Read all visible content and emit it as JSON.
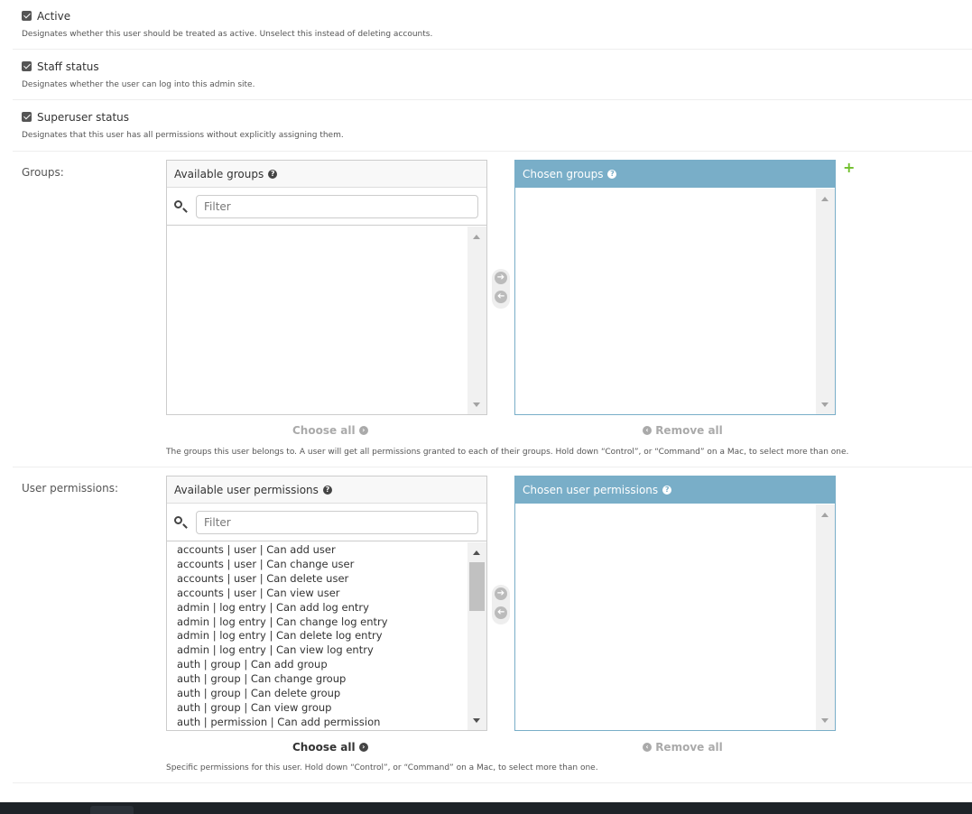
{
  "checkboxes": [
    {
      "label": "Active",
      "checked": true,
      "help": "Designates whether this user should be treated as active. Unselect this instead of deleting accounts."
    },
    {
      "label": "Staff status",
      "checked": true,
      "help": "Designates whether the user can log into this admin site."
    },
    {
      "label": "Superuser status",
      "checked": true,
      "help": "Designates that this user has all permissions without explicitly assigning them."
    }
  ],
  "groups": {
    "label": "Groups:",
    "available_title": "Available groups",
    "chosen_title": "Chosen groups",
    "filter_placeholder": "Filter",
    "available_items": [],
    "chosen_items": [],
    "choose_all": "Choose all",
    "remove_all": "Remove all",
    "help": "The groups this user belongs to. A user will get all permissions granted to each of their groups. Hold down “Control”, or “Command” on a Mac, to select more than one."
  },
  "permissions": {
    "label": "User permissions:",
    "available_title": "Available user permissions",
    "chosen_title": "Chosen user permissions",
    "filter_placeholder": "Filter",
    "available_items": [
      "accounts | user | Can add user",
      "accounts | user | Can change user",
      "accounts | user | Can delete user",
      "accounts | user | Can view user",
      "admin | log entry | Can add log entry",
      "admin | log entry | Can change log entry",
      "admin | log entry | Can delete log entry",
      "admin | log entry | Can view log entry",
      "auth | group | Can add group",
      "auth | group | Can change group",
      "auth | group | Can delete group",
      "auth | group | Can view group",
      "auth | permission | Can add permission"
    ],
    "chosen_items": [],
    "choose_all": "Choose all",
    "remove_all": "Remove all",
    "help": "Specific permissions for this user. Hold down “Control”, or “Command” on a Mac, to select more than one."
  },
  "colors": {
    "accent": "#79aec8",
    "add_green": "#70bf2b",
    "footer": "#1e2328"
  }
}
